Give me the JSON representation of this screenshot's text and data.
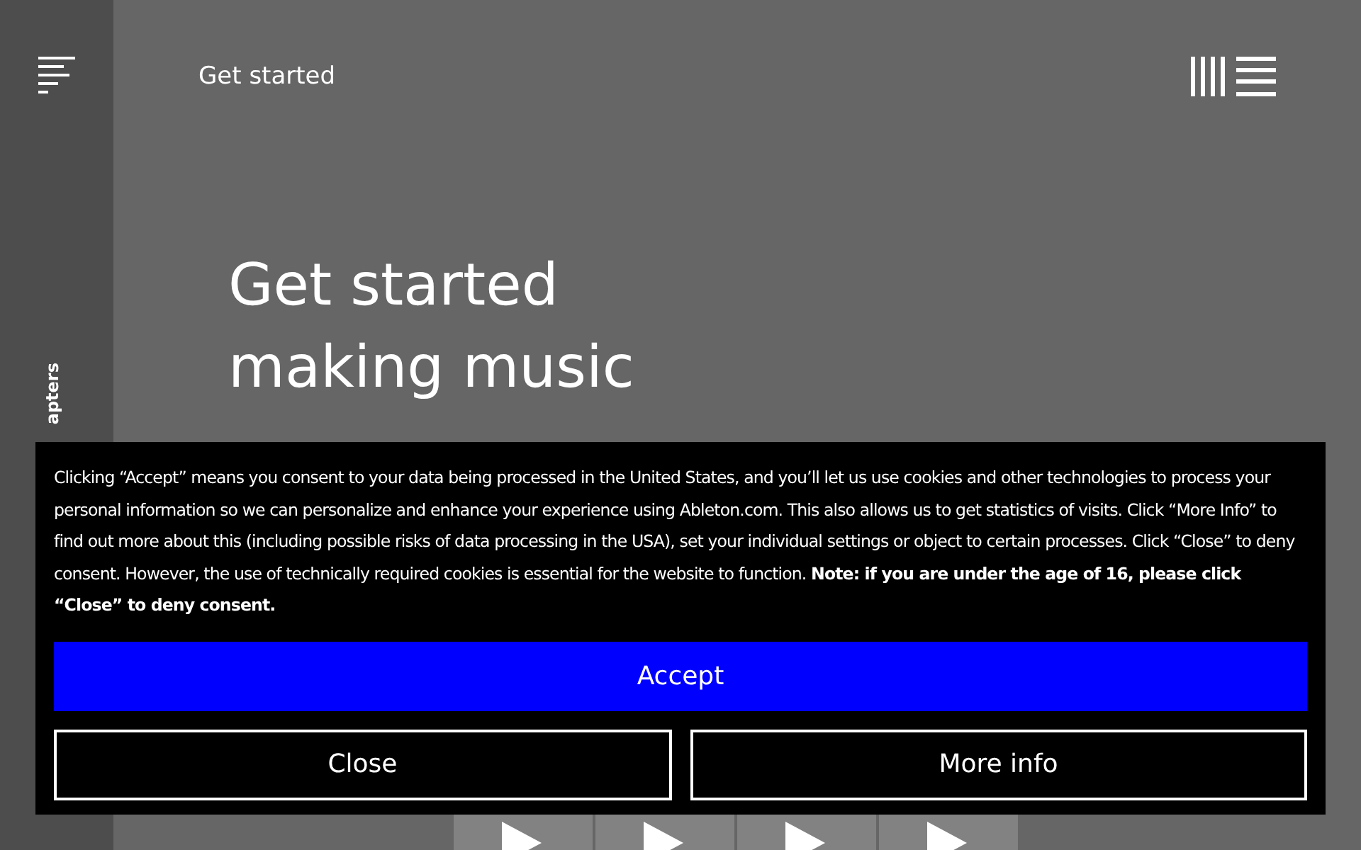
{
  "sidebar": {
    "vertical_label": "apters"
  },
  "header": {
    "title": "Get started"
  },
  "hero": {
    "heading_lines": [
      "Get started",
      "making music"
    ]
  },
  "tiles": [
    {
      "kind": "play"
    },
    {
      "kind": "play"
    },
    {
      "kind": "play"
    },
    {
      "kind": "play"
    }
  ],
  "cookie_banner": {
    "text": "Clicking “Accept” means you consent to your data being processed in the United States, and you’ll let us use cookies and other technologies to process your personal information so we can personalize and enhance your experience using Ableton.com. This also allows us to get statistics of visits. Click “More Info” to find out more about this (including possible risks of data processing in the USA), set your individual settings or object to certain processes. Click “Close” to deny consent. However, the use of technically required cookies is essential for the website to function. **Note: if you are under the age of 16, please click “Close” to deny consent.**",
    "accept": "Accept",
    "close": "Close",
    "more_info": "More info"
  }
}
